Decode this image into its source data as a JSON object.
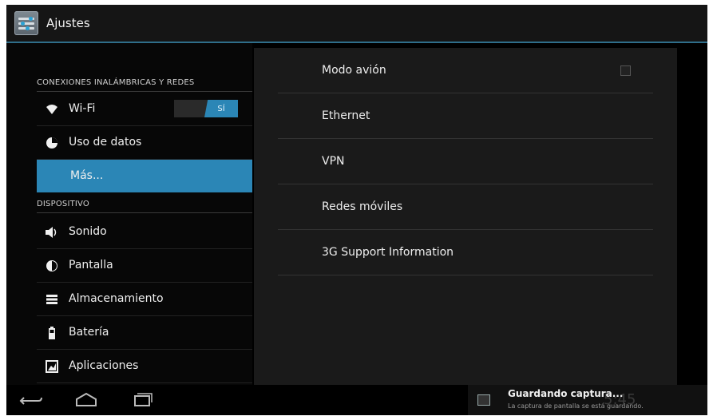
{
  "actionbar": {
    "title": "Ajustes",
    "icon": "settings-sliders-icon"
  },
  "left_pane": {
    "sections": [
      {
        "header": "CONEXIONES INALÁMBRICAS Y REDES",
        "items": [
          {
            "label": "Wi-Fi",
            "icon": "wifi-icon",
            "toggle": "SÍ"
          },
          {
            "label": "Uso de datos",
            "icon": "data-usage-icon"
          },
          {
            "label": "Más...",
            "icon": "",
            "selected": true
          }
        ]
      },
      {
        "header": "DISPOSITIVO",
        "items": [
          {
            "label": "Sonido",
            "icon": "speaker-icon"
          },
          {
            "label": "Pantalla",
            "icon": "brightness-icon"
          },
          {
            "label": "Almacenamiento",
            "icon": "storage-icon"
          },
          {
            "label": "Batería",
            "icon": "battery-icon"
          },
          {
            "label": "Aplicaciones",
            "icon": "apps-icon"
          }
        ]
      }
    ]
  },
  "right_pane": {
    "items": [
      {
        "label": "Modo avión",
        "checkbox": false
      },
      {
        "label": "Ethernet"
      },
      {
        "label": "VPN"
      },
      {
        "label": "Redes móviles"
      },
      {
        "label": "3G Support Information"
      }
    ]
  },
  "navbar": {
    "buttons": [
      "back-icon",
      "home-icon",
      "recent-apps-icon"
    ],
    "notification": {
      "title": "Guardando captura...",
      "subtitle": "La captura de pantalla se está guardando.",
      "ghost_time": "5:45"
    }
  },
  "colors": {
    "accent": "#2b86b6",
    "background": "#000000",
    "right_pane": "#1a1a1a"
  }
}
